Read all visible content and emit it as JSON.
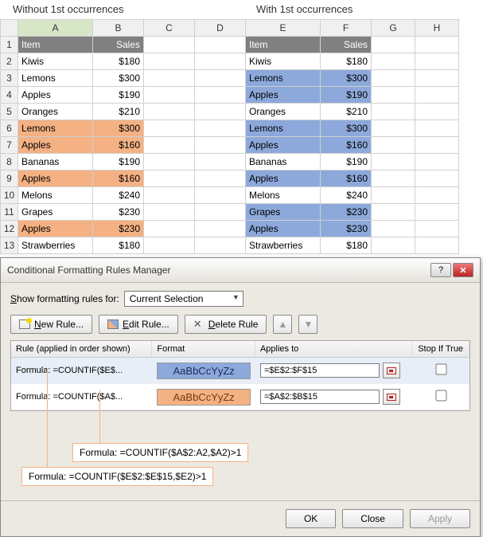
{
  "labels": {
    "without": "Without 1st occurrences",
    "with": "With 1st occurrences"
  },
  "columns": [
    "A",
    "B",
    "C",
    "D",
    "E",
    "F",
    "G",
    "H"
  ],
  "header": {
    "item": "Item",
    "sales": "Sales"
  },
  "left_rows": [
    {
      "item": "Kiwis",
      "sales": "$180",
      "hl": false
    },
    {
      "item": "Lemons",
      "sales": "$300",
      "hl": false
    },
    {
      "item": "Apples",
      "sales": "$190",
      "hl": false
    },
    {
      "item": "Oranges",
      "sales": "$210",
      "hl": false
    },
    {
      "item": "Lemons",
      "sales": "$300",
      "hl": true
    },
    {
      "item": "Apples",
      "sales": "$160",
      "hl": true
    },
    {
      "item": "Bananas",
      "sales": "$190",
      "hl": false
    },
    {
      "item": "Apples",
      "sales": "$160",
      "hl": true
    },
    {
      "item": "Melons",
      "sales": "$240",
      "hl": false
    },
    {
      "item": "Grapes",
      "sales": "$230",
      "hl": false
    },
    {
      "item": "Apples",
      "sales": "$230",
      "hl": true
    },
    {
      "item": "Strawberries",
      "sales": "$180",
      "hl": false
    }
  ],
  "right_rows": [
    {
      "item": "Kiwis",
      "sales": "$180",
      "hl": false
    },
    {
      "item": "Lemons",
      "sales": "$300",
      "hl": true
    },
    {
      "item": "Apples",
      "sales": "$190",
      "hl": true
    },
    {
      "item": "Oranges",
      "sales": "$210",
      "hl": false
    },
    {
      "item": "Lemons",
      "sales": "$300",
      "hl": true
    },
    {
      "item": "Apples",
      "sales": "$160",
      "hl": true
    },
    {
      "item": "Bananas",
      "sales": "$190",
      "hl": false
    },
    {
      "item": "Apples",
      "sales": "$160",
      "hl": true
    },
    {
      "item": "Melons",
      "sales": "$240",
      "hl": false
    },
    {
      "item": "Grapes",
      "sales": "$230",
      "hl": true
    },
    {
      "item": "Apples",
      "sales": "$230",
      "hl": true
    },
    {
      "item": "Strawberries",
      "sales": "$180",
      "hl": false
    }
  ],
  "dialog": {
    "title": "Conditional Formatting Rules Manager",
    "show_label": "Show formatting rules for:",
    "show_value": "Current Selection",
    "new_btn": "New Rule...",
    "edit_btn": "Edit Rule...",
    "delete_btn": "Delete Rule",
    "hdr_rule": "Rule (applied in order shown)",
    "hdr_format": "Format",
    "hdr_applies": "Applies to",
    "hdr_stop": "Stop If True",
    "rules": [
      {
        "name": "Formula: =COUNTIF($E$...",
        "preview": "AaBbCcYyZz",
        "prevClass": "prev-blue",
        "applies": "=$E$2:$F$15",
        "selected": true
      },
      {
        "name": "Formula: =COUNTIF($A$...",
        "preview": "AaBbCcYyZz",
        "prevClass": "prev-orange",
        "applies": "=$A$2:$B$15",
        "selected": false
      }
    ],
    "callout1": "Formula: =COUNTIF($A$2:A2,$A2)>1",
    "callout2": "Formula: =COUNTIF($E$2:$E$15,$E2)>1",
    "ok": "OK",
    "close": "Close",
    "apply": "Apply"
  }
}
